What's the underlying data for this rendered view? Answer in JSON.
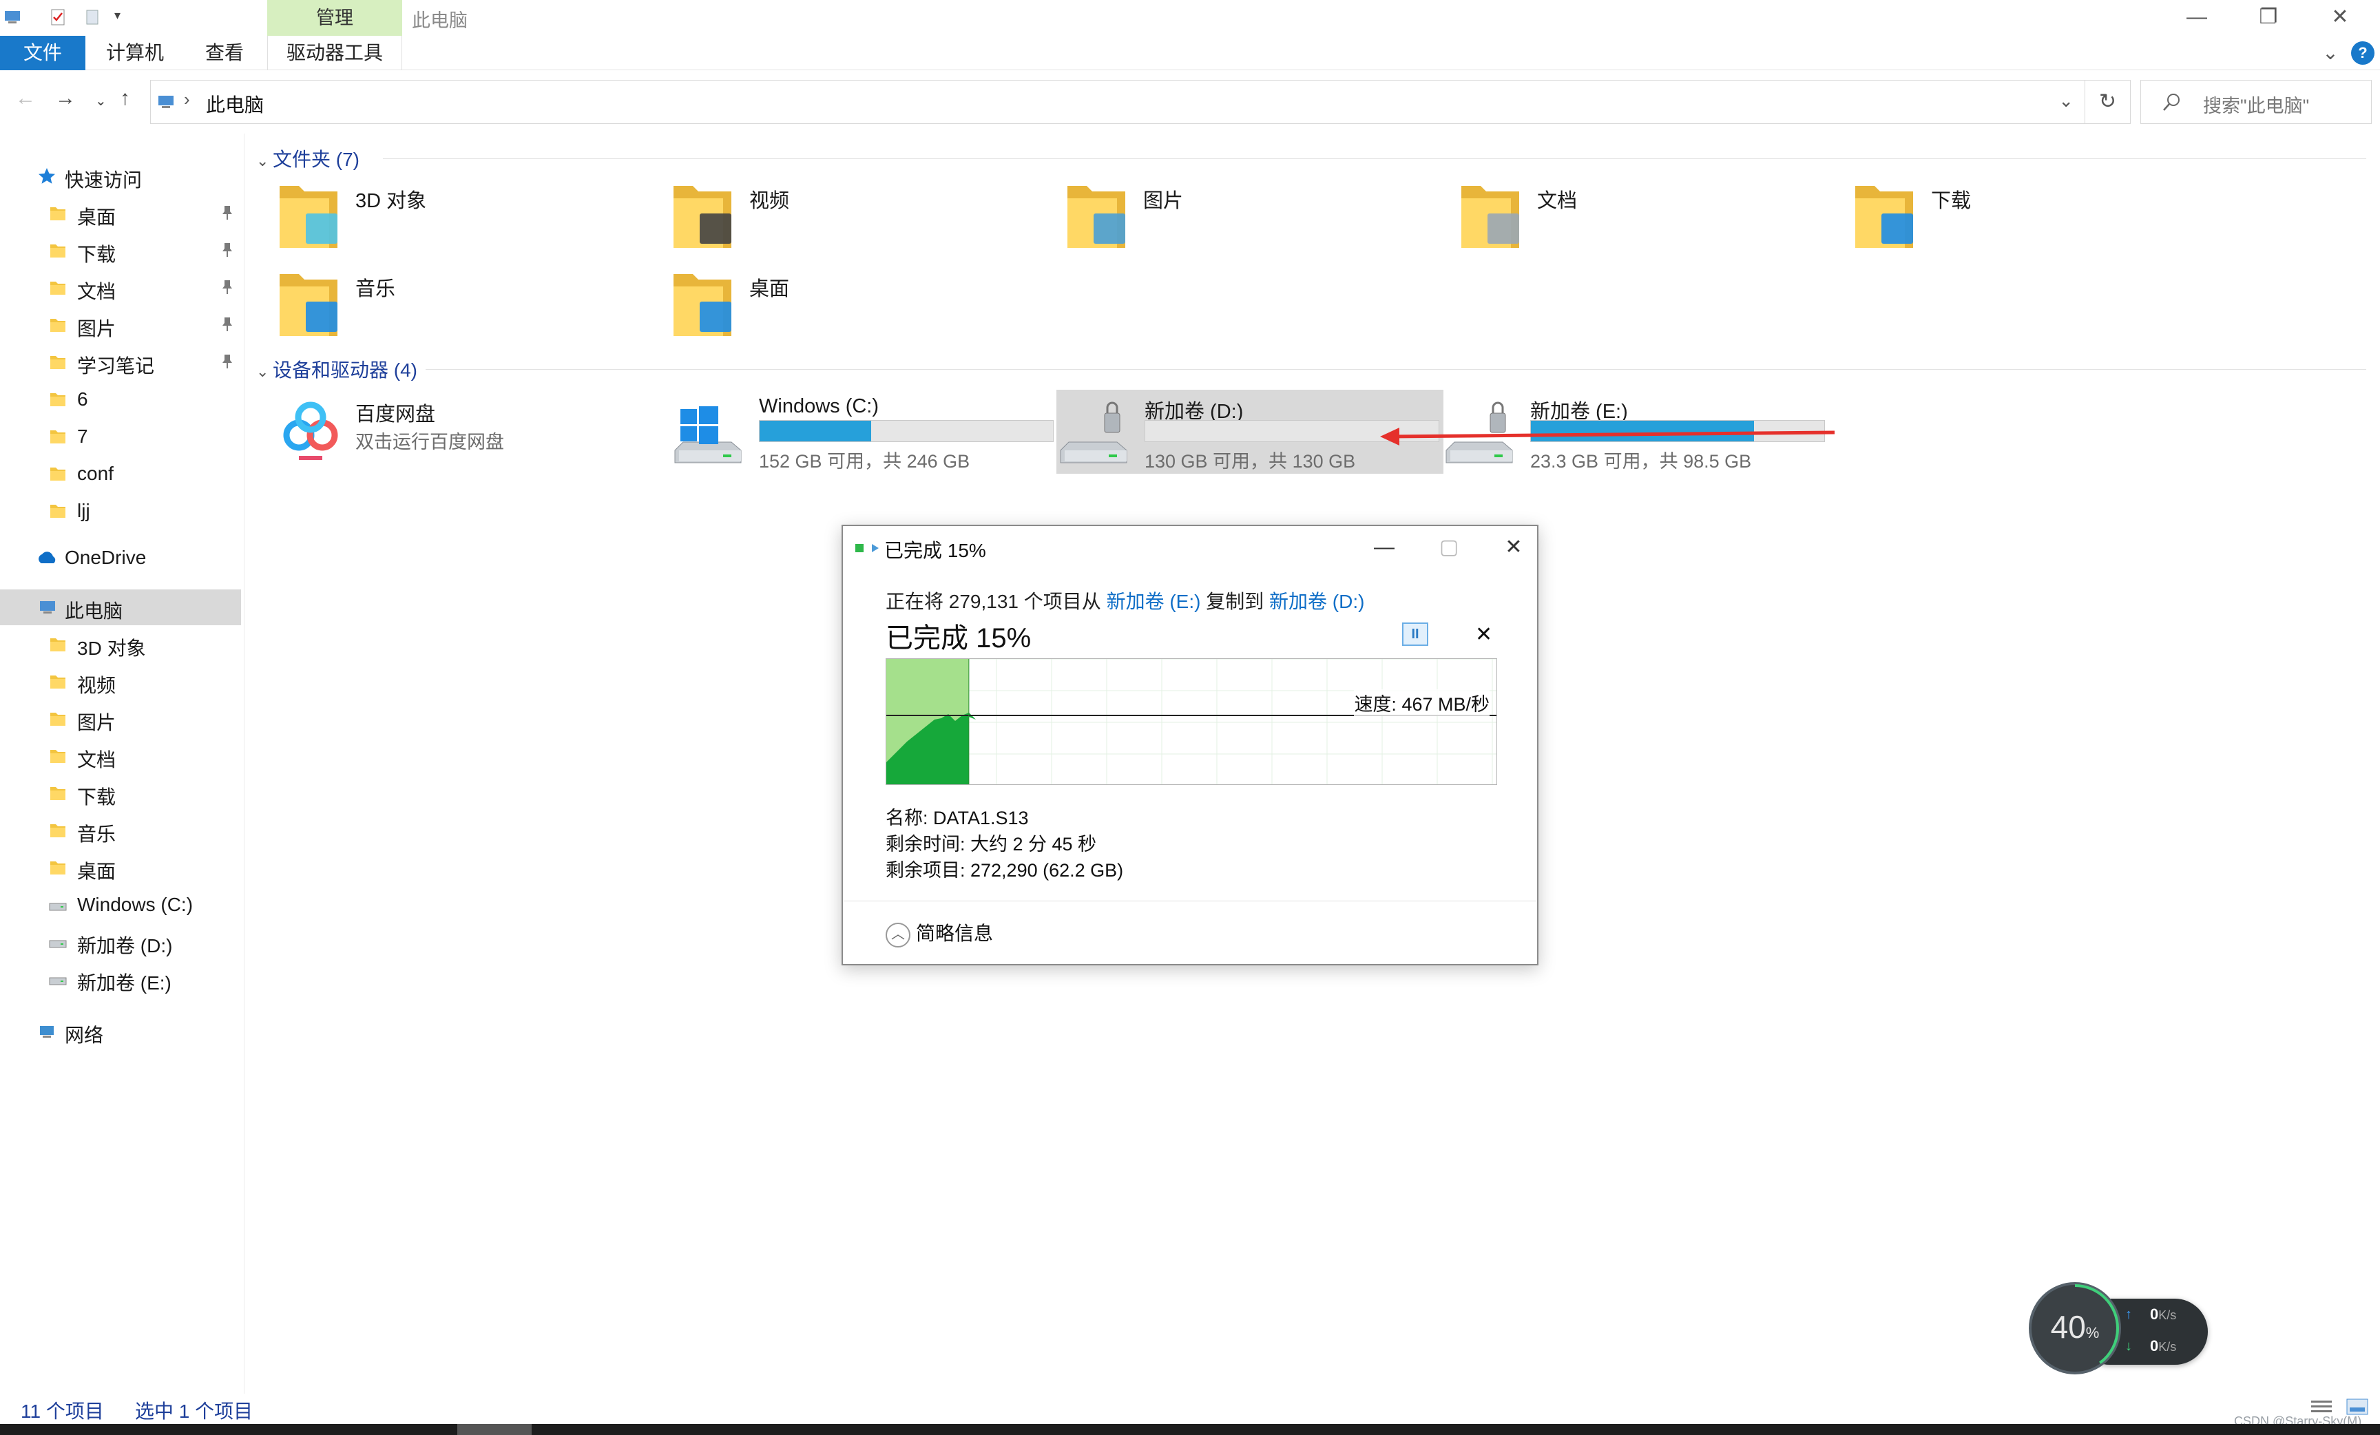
{
  "window": {
    "title": "此电脑",
    "context_tab": "管理",
    "minimize": "—",
    "maximize": "❐",
    "close": "✕"
  },
  "ribbon": {
    "tabs": [
      "文件",
      "计算机",
      "查看",
      "驱动器工具"
    ],
    "collapse": "⌄",
    "help": "?"
  },
  "address": {
    "path": "此电脑",
    "search_placeholder": "搜索\"此电脑\""
  },
  "sidebar": {
    "quick_access": "快速访问",
    "quick_items": [
      "桌面",
      "下载",
      "文档",
      "图片",
      "学习笔记",
      "6",
      "7",
      "conf",
      "ljj"
    ],
    "onedrive": "OneDrive",
    "this_pc": "此电脑",
    "pc_items": [
      "3D 对象",
      "视频",
      "图片",
      "文档",
      "下载",
      "音乐",
      "桌面",
      "Windows (C:)",
      "新加卷 (D:)",
      "新加卷 (E:)"
    ],
    "network": "网络"
  },
  "folders": {
    "header": "文件夹 (7)",
    "items": [
      "3D 对象",
      "视频",
      "图片",
      "文档",
      "下载",
      "音乐",
      "桌面"
    ]
  },
  "devices": {
    "header": "设备和驱动器 (4)",
    "baidu": {
      "name": "百度网盘",
      "sub": "双击运行百度网盘"
    },
    "drives": [
      {
        "name": "Windows (C:)",
        "free": "152 GB 可用，共 246 GB",
        "used_fraction": 0.38,
        "color": "#26a0da"
      },
      {
        "name": "新加卷 (D:)",
        "free": "130 GB 可用，共 130 GB",
        "used_fraction": 0.0,
        "color": "#26a0da"
      },
      {
        "name": "新加卷 (E:)",
        "free": "23.3 GB 可用，共 98.5 GB",
        "used_fraction": 0.76,
        "color": "#26a0da"
      }
    ]
  },
  "dialog": {
    "title": "已完成 15%",
    "line_prefix": "正在将 279,131 个项目从 ",
    "source": "新加卷 (E:)",
    "line_mid": " 复制到 ",
    "dest": "新加卷 (D:)",
    "status": "已完成 15%",
    "progress": 0.15,
    "speed": "速度: 467 MB/秒",
    "name_line": "名称:  DATA1.S13",
    "time_line": "剩余时间:  大约 2 分 45 秒",
    "items_line": "剩余项目:  272,290 (62.2 GB)",
    "details": "简略信息",
    "pause": "II",
    "stop": "✕"
  },
  "status": {
    "count": "11 个项目",
    "selected": "选中 1 个项目"
  },
  "net_widget": {
    "percent": "40",
    "unit": "%",
    "up": "0",
    "down": "0",
    "rate_unit": "K/s"
  },
  "watermark": "CSDN @Starry-Sky(M)"
}
